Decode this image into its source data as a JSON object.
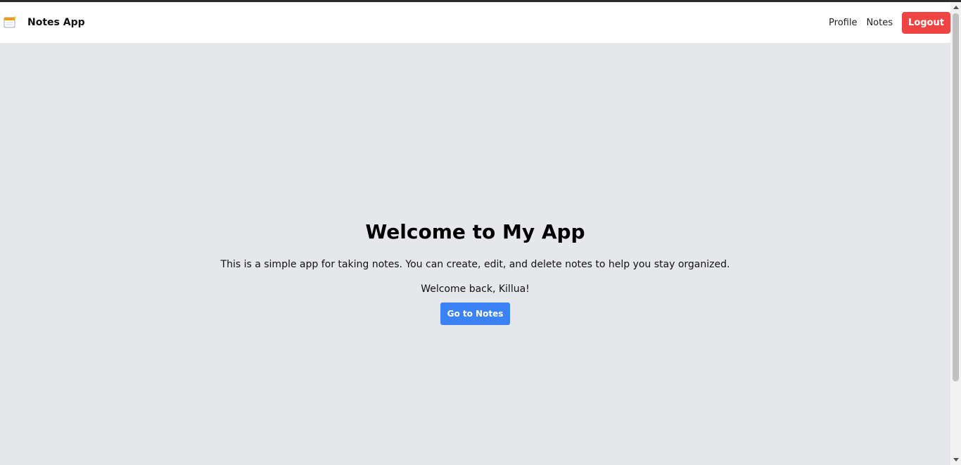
{
  "header": {
    "brand_title": "Notes App",
    "logo_icon": "notepad-icon",
    "nav_links": [
      {
        "label": "Profile"
      },
      {
        "label": "Notes"
      }
    ],
    "logout_label": "Logout"
  },
  "main": {
    "title": "Welcome to My App",
    "description": "This is a simple app for taking notes. You can create, edit, and delete notes to help you stay organized.",
    "welcome_message": "Welcome back, Killua!",
    "cta_label": "Go to Notes"
  },
  "colors": {
    "background": "#e5e7eb",
    "navbar": "#ffffff",
    "logout_button": "#ef4444",
    "cta_button": "#3b82f6"
  }
}
